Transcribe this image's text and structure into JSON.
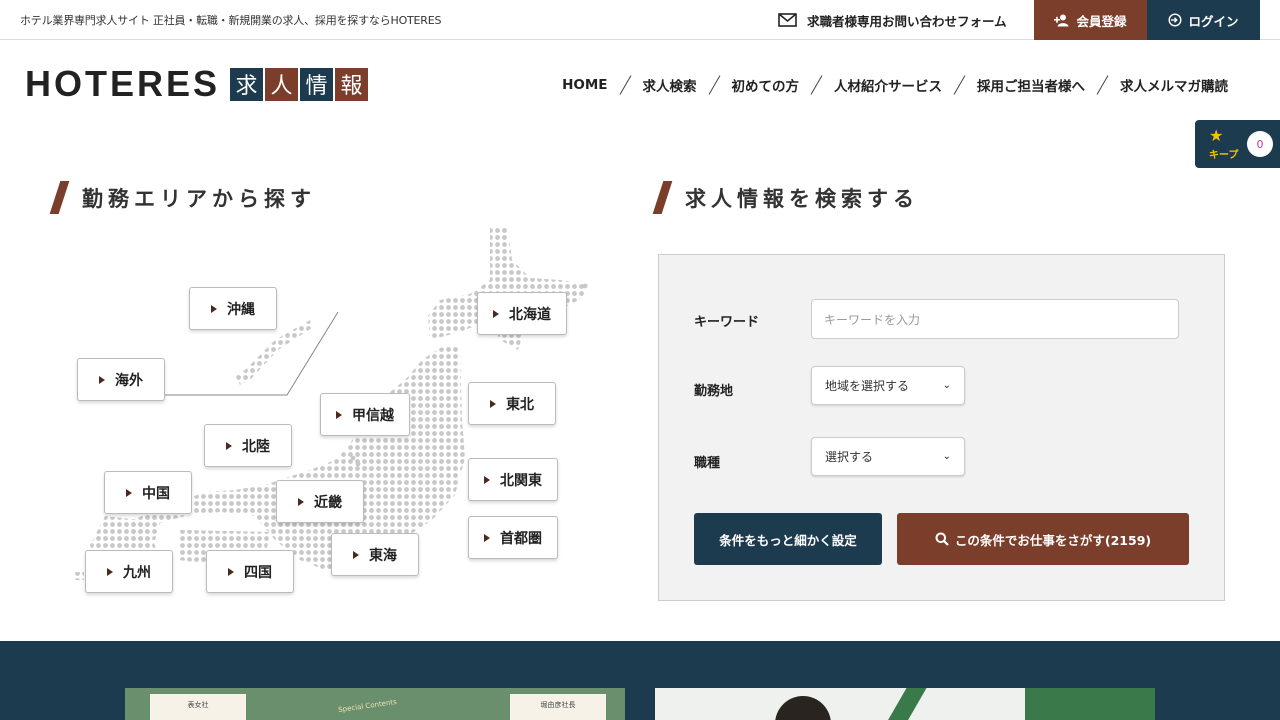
{
  "topbar": {
    "tagline": "ホテル業界専門求人サイト 正社員・転職・新規開業の求人、採用を探すならHOTERES",
    "contact_label": "求職者様専用お問い合わせフォーム",
    "register_label": "会員登録",
    "login_label": "ログイン"
  },
  "header": {
    "logo_text": "HOTERES",
    "logo_chars": [
      "求",
      "人",
      "情",
      "報"
    ],
    "nav": [
      "HOME",
      "求人検索",
      "初めての方",
      "人材紹介サービス",
      "採用ご担当者様へ",
      "求人メルマガ購読"
    ]
  },
  "keep": {
    "label": "キープ",
    "count": "0"
  },
  "area": {
    "heading": "勤務エリアから探す",
    "regions": {
      "okinawa": "沖縄",
      "kaigai": "海外",
      "hokkaido": "北海道",
      "tohoku": "東北",
      "koshinetsu": "甲信越",
      "hokuriku": "北陸",
      "kitakanto": "北関東",
      "chugoku": "中国",
      "kinki": "近畿",
      "shutoken": "首都圏",
      "kyushu": "九州",
      "shikoku": "四国",
      "tokai": "東海"
    }
  },
  "search": {
    "heading": "求人情報を検索する",
    "keyword_label": "キーワード",
    "keyword_placeholder": "キーワードを入力",
    "location_label": "勤務地",
    "location_value": "地域を選択する",
    "job_label": "職種",
    "job_value": "選択する",
    "detail_button": "条件をもっと細かく設定",
    "search_button": "この条件でお仕事をさがす(2159)"
  },
  "banners": {
    "card1_text": "表女社",
    "arc_text": "Special Contents",
    "card2_text": "堀由彦社長"
  },
  "colors": {
    "navy": "#1d3b4f",
    "brown": "#7a3e2b",
    "star": "#f5c400"
  }
}
